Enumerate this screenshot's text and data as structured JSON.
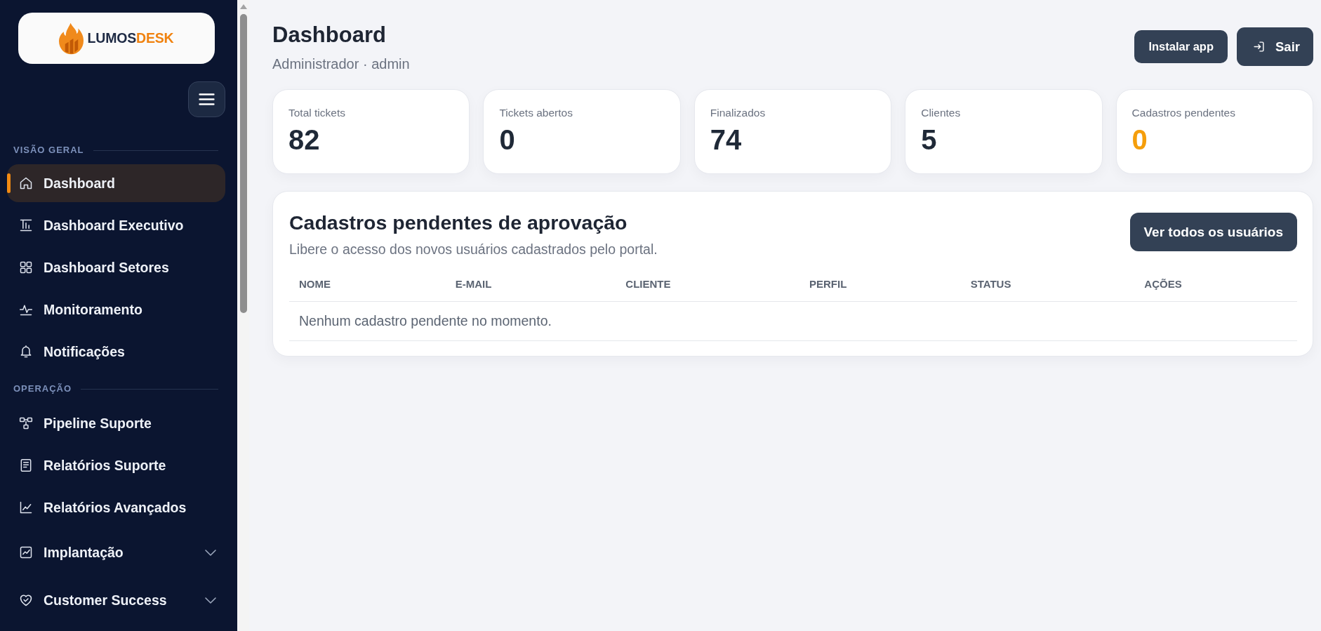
{
  "sidebar": {
    "logo": {
      "text": "LUMOS",
      "accent_text": "DESK"
    },
    "sections": [
      {
        "title": "VISÃO GERAL",
        "items": [
          {
            "label": "Dashboard",
            "kind": "link",
            "selected": true
          },
          {
            "label": "Dashboard Executivo",
            "kind": "link",
            "selected": false
          },
          {
            "label": "Dashboard Setores",
            "kind": "link",
            "selected": false
          },
          {
            "label": "Monitoramento",
            "kind": "link",
            "selected": false
          },
          {
            "label": "Notificações",
            "kind": "link",
            "selected": false
          }
        ]
      },
      {
        "title": "OPERAÇÃO",
        "items": [
          {
            "label": "Pipeline Suporte",
            "kind": "link",
            "selected": false
          },
          {
            "label": "Relatórios Suporte",
            "kind": "link",
            "selected": false
          },
          {
            "label": "Relatórios Avançados",
            "kind": "link",
            "selected": false
          },
          {
            "label": "Implantação",
            "kind": "group",
            "selected": false,
            "expanded": false
          },
          {
            "label": "Customer Success",
            "kind": "group",
            "selected": false,
            "expanded": false
          }
        ]
      }
    ]
  },
  "header": {
    "title": "Dashboard",
    "subtitle": "Administrador · admin",
    "buttons": [
      {
        "label": "Instalar app",
        "kind": "install"
      },
      {
        "label": "Sair",
        "kind": "logout"
      }
    ]
  },
  "stats": [
    {
      "label": "Total tickets",
      "value": "82",
      "color": "#1f2937"
    },
    {
      "label": "Tickets abertos",
      "value": "0",
      "color": "#1f2937"
    },
    {
      "label": "Finalizados",
      "value": "74",
      "color": "#1f2937"
    },
    {
      "label": "Clientes",
      "value": "5",
      "color": "#1f2937"
    },
    {
      "label": "Cadastros pendentes",
      "value": "0",
      "color": "#f59e0b"
    }
  ],
  "pending_panel": {
    "title": "Cadastros pendentes de aprovação",
    "subtitle": "Libere o acesso dos novos usuários cadastrados pelo portal.",
    "button": "Ver todos os usuários",
    "table": {
      "columns": [
        "NOME",
        "E-MAIL",
        "CLIENTE",
        "PERFIL",
        "STATUS",
        "AÇÕES"
      ],
      "empty_message": "Nenhum cadastro pendente no momento."
    }
  }
}
